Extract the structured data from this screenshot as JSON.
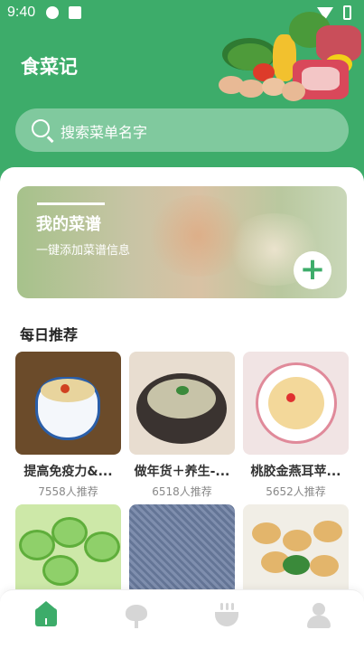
{
  "status_bar": {
    "time": "9:40"
  },
  "app": {
    "title": "食菜记"
  },
  "search": {
    "placeholder": "搜索菜单名字"
  },
  "banner": {
    "title": "我的菜谱",
    "subtitle": "一键添加菜谱信息",
    "add_icon": "plus-icon"
  },
  "section": {
    "daily_title": "每日推荐"
  },
  "recipes": [
    {
      "name": "提高免疫力&...",
      "count": "7558人推荐"
    },
    {
      "name": "做年货＋养生-...",
      "count": "6518人推荐"
    },
    {
      "name": "桃胶金燕耳苹...",
      "count": "5652人推荐"
    },
    {
      "name": "",
      "count": ""
    },
    {
      "name": "",
      "count": ""
    },
    {
      "name": "",
      "count": ""
    }
  ],
  "bottom_nav": [
    {
      "icon": "home-icon",
      "active": true
    },
    {
      "icon": "vegetable-icon",
      "active": false
    },
    {
      "icon": "bowl-icon",
      "active": false
    },
    {
      "icon": "user-icon",
      "active": false
    }
  ],
  "colors": {
    "primary": "#3dac6a",
    "inactive_nav": "#d6d6d6"
  }
}
